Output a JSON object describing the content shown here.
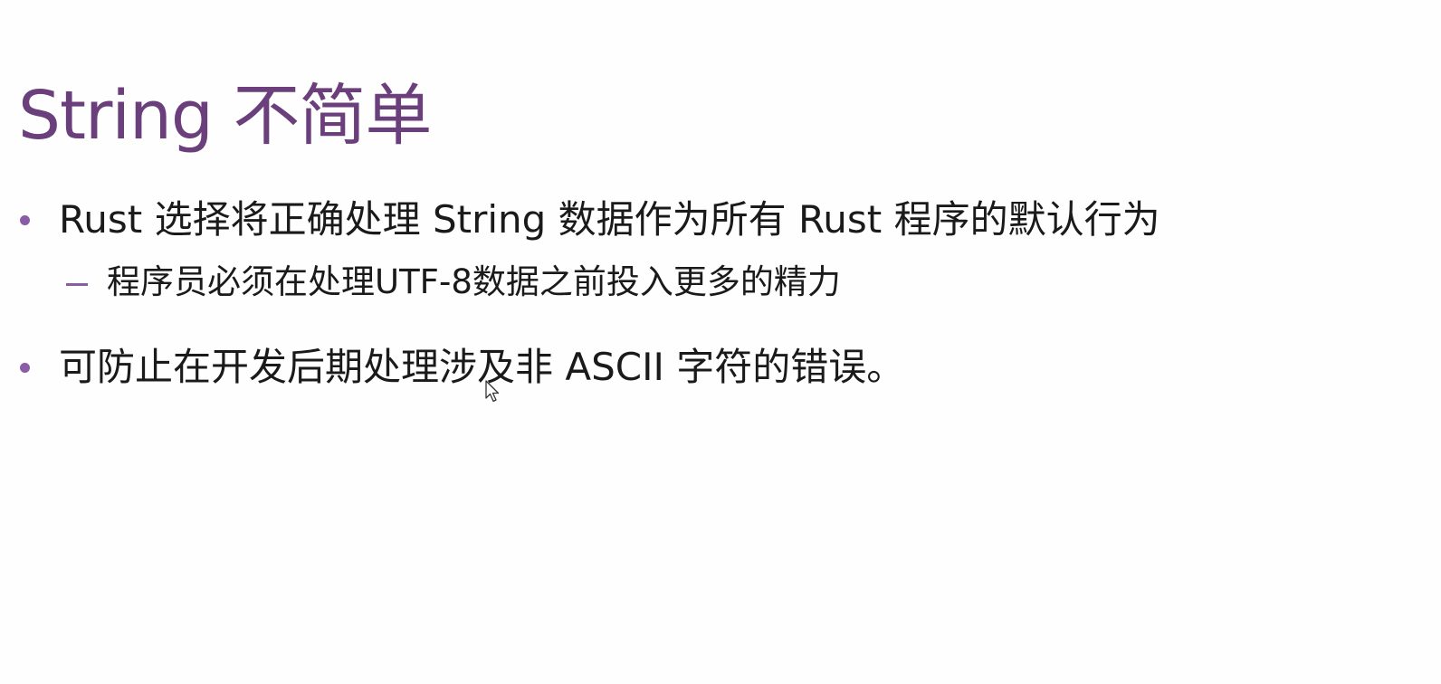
{
  "slide": {
    "title": "String 不简单",
    "bullets": [
      {
        "text": "Rust 选择将正确处理 String 数据作为所有 Rust 程序的默认行为",
        "sub": [
          "程序员必须在处理UTF-8数据之前投入更多的精力"
        ]
      },
      {
        "text": "可防止在开发后期处理涉及非 ASCII 字符的错误。"
      }
    ]
  },
  "colors": {
    "title": "#6b3f7c",
    "bullet_marker": "#8a5ca6",
    "body_text": "#1a1a1a",
    "background": "#fefefe"
  },
  "icons": {
    "pointer": "mouse-pointer-icon"
  }
}
